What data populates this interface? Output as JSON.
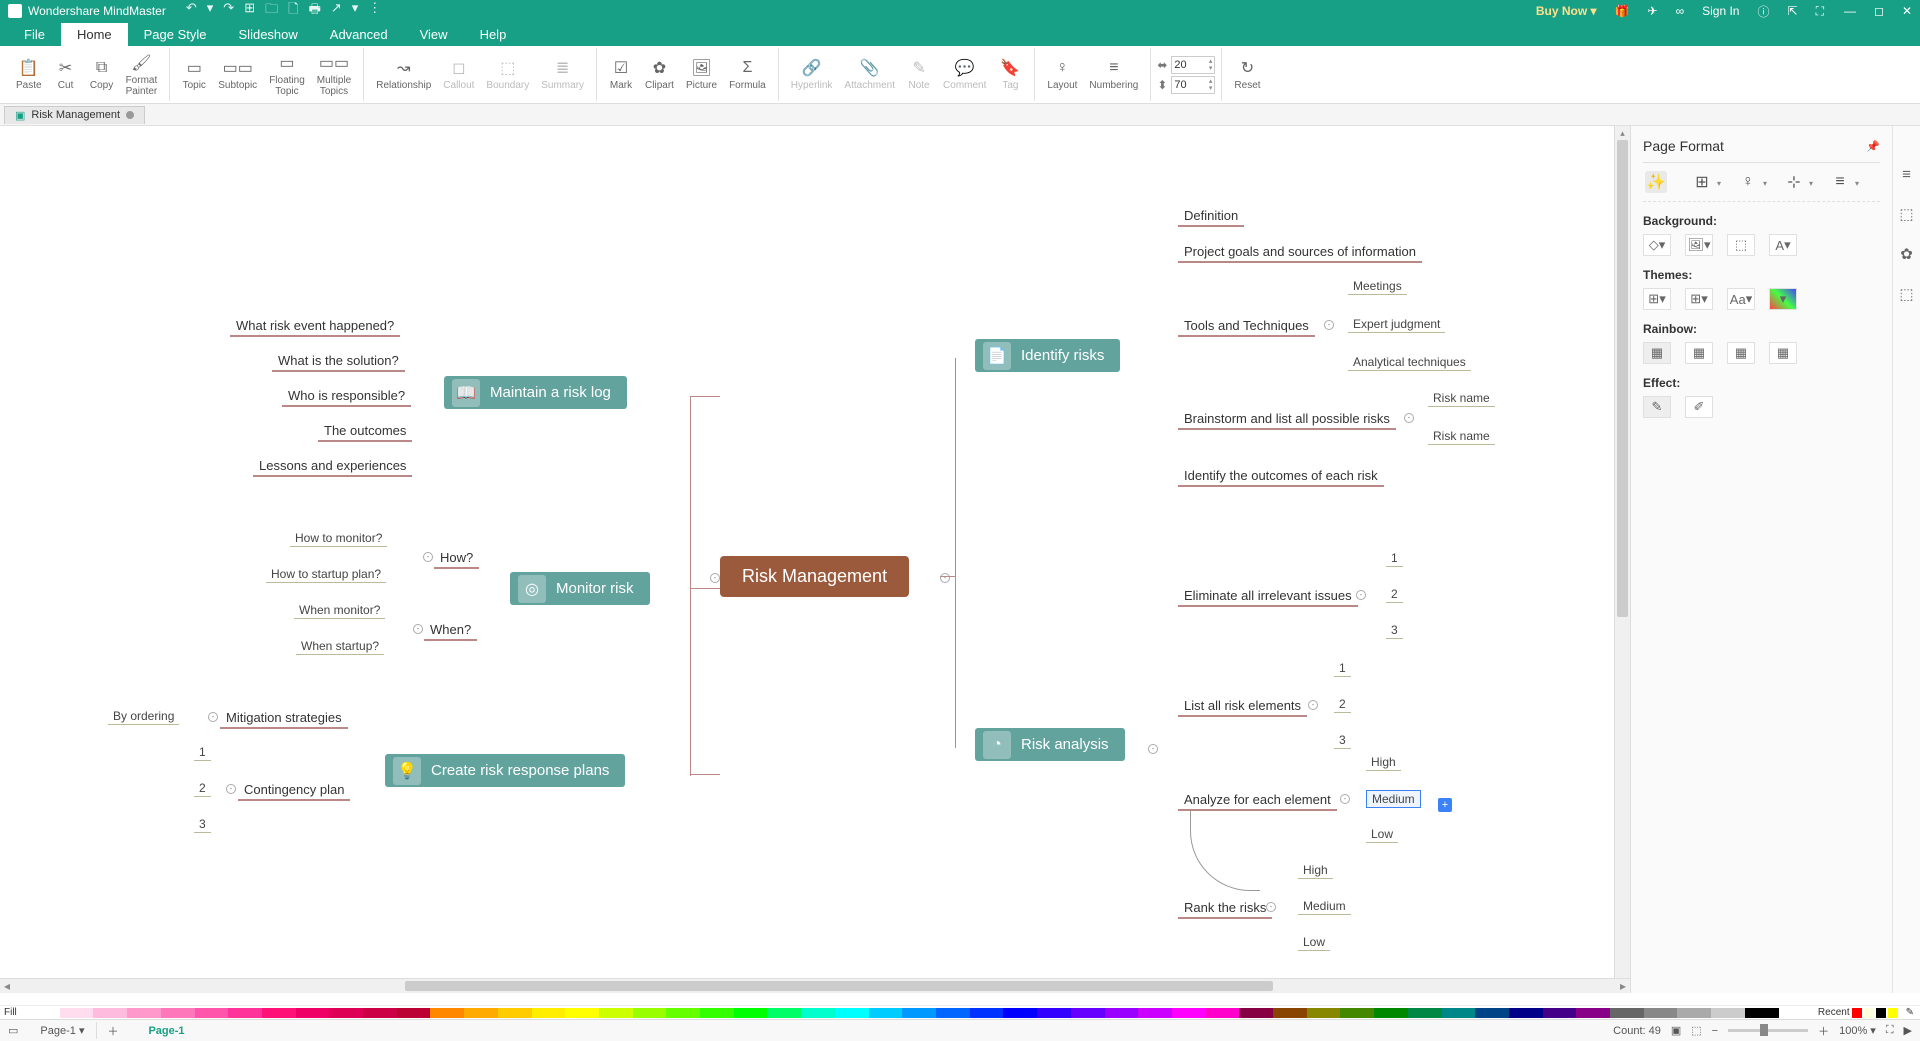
{
  "app": {
    "title": "Wondershare MindMaster"
  },
  "qat_icons": [
    "↶",
    "▾",
    "↷",
    "⊞",
    "🗀",
    "🗋",
    "🖶",
    "↗",
    "▾",
    "⋮"
  ],
  "titlebar_right": {
    "buy": "Buy Now ▾",
    "signin": "Sign In"
  },
  "menu_tabs": [
    "File",
    "Home",
    "Page Style",
    "Slideshow",
    "Advanced",
    "View",
    "Help"
  ],
  "menu_active": 1,
  "ribbon": {
    "groups": [
      {
        "items": [
          {
            "icon": "📋",
            "label": "Paste"
          },
          {
            "icon": "✂",
            "label": "Cut"
          },
          {
            "icon": "⧉",
            "label": "Copy"
          },
          {
            "icon": "🖌",
            "label": "Format\nPainter",
            "dd": true
          }
        ]
      },
      {
        "items": [
          {
            "icon": "▭",
            "label": "Topic"
          },
          {
            "icon": "▭▭",
            "label": "Subtopic"
          },
          {
            "icon": "▭",
            "label": "Floating\nTopic"
          },
          {
            "icon": "▭▭",
            "label": "Multiple\nTopics"
          }
        ]
      },
      {
        "items": [
          {
            "icon": "↝",
            "label": "Relationship"
          },
          {
            "icon": "◻",
            "label": "Callout",
            "dim": true
          },
          {
            "icon": "⬚",
            "label": "Boundary",
            "dim": true
          },
          {
            "icon": "≣",
            "label": "Summary",
            "dim": true
          }
        ]
      },
      {
        "items": [
          {
            "icon": "☑",
            "label": "Mark"
          },
          {
            "icon": "✿",
            "label": "Clipart"
          },
          {
            "icon": "🖼",
            "label": "Picture"
          },
          {
            "icon": "Σ",
            "label": "Formula"
          }
        ]
      },
      {
        "items": [
          {
            "icon": "🔗",
            "label": "Hyperlink",
            "dim": true
          },
          {
            "icon": "📎",
            "label": "Attachment",
            "dim": true
          },
          {
            "icon": "✎",
            "label": "Note",
            "dim": true
          },
          {
            "icon": "💬",
            "label": "Comment",
            "dim": true
          },
          {
            "icon": "🔖",
            "label": "Tag",
            "dim": true
          }
        ]
      },
      {
        "items": [
          {
            "icon": "♀",
            "label": "Layout",
            "dd": true
          },
          {
            "icon": "≡",
            "label": "Numbering",
            "dd": true
          }
        ]
      },
      {
        "spinners": [
          {
            "icon": "⬌",
            "value": "20"
          },
          {
            "icon": "⬍",
            "value": "70"
          }
        ],
        "reset": {
          "icon": "↻",
          "label": "Reset"
        }
      }
    ]
  },
  "doc_tab": "Risk Management",
  "mindmap": {
    "central": "Risk Management",
    "left": [
      {
        "title": "Maintain a risk log",
        "icon": "📖",
        "children": [
          "What risk event happened?",
          "What is the solution?",
          "Who is responsible?",
          "The outcomes",
          "Lessons and experiences"
        ]
      },
      {
        "title": "Monitor risk",
        "icon": "◎",
        "groups": [
          {
            "q": "How?",
            "items": [
              "How to monitor?",
              "How to startup plan?"
            ]
          },
          {
            "q": "When?",
            "items": [
              "When monitor?",
              "When startup?"
            ]
          }
        ]
      },
      {
        "title": "Create risk response plans",
        "icon": "💡",
        "pairs": [
          {
            "label": "Mitigation strategies",
            "left": "By ordering"
          },
          {
            "label": "Contingency plan",
            "nums": [
              "1",
              "2",
              "3"
            ]
          }
        ]
      }
    ],
    "right": [
      {
        "title": "Identify risks",
        "icon": "📄",
        "children": [
          {
            "t": "Definition"
          },
          {
            "t": "Project goals and sources of information"
          },
          {
            "t": "Tools and Techniques",
            "sub": [
              "Meetings",
              "Expert judgment",
              "Analytical techniques"
            ]
          },
          {
            "t": "Brainstorm and list all possible risks",
            "sub": [
              "Risk name",
              "Risk name"
            ]
          },
          {
            "t": "Identify the outcomes of each risk"
          }
        ]
      },
      {
        "title": "Risk analysis",
        "icon": "◔",
        "children": [
          {
            "t": "Eliminate all irrelevant issues",
            "sub": [
              "1",
              "2",
              "3"
            ]
          },
          {
            "t": "List all risk elements",
            "sub": [
              "1",
              "2",
              "3"
            ]
          },
          {
            "t": "Analyze for each element",
            "sub": [
              "High",
              "Medium",
              "Low"
            ],
            "sel": 1
          },
          {
            "t": "Rank the risks",
            "sub": [
              "High",
              "Medium",
              "Low"
            ]
          }
        ]
      }
    ]
  },
  "sidepanel": {
    "title": "Page Format",
    "toprow": [
      "✨",
      "⊞",
      "♀",
      "⊹",
      "≡"
    ],
    "background": "Background:",
    "bg_icons": [
      "◇",
      "🖼",
      "⬚",
      "A"
    ],
    "themes": "Themes:",
    "theme_icons": [
      "⊞",
      "⊞",
      "Aa",
      "▦"
    ],
    "rainbow": "Rainbow:",
    "effect": "Effect:",
    "vtabs": [
      "≡",
      "⬚",
      "✿",
      "⬚"
    ]
  },
  "colorbar": {
    "label": "Fill",
    "recent": "Recent",
    "colors": [
      "#ffffff",
      "#fde",
      "#fbd",
      "#f9c",
      "#f7b",
      "#f5a",
      "#f39",
      "#f17",
      "#e06",
      "#d05",
      "#c04",
      "#b03",
      "#f80",
      "#fa0",
      "#fc0",
      "#fe0",
      "#ff0",
      "#cf0",
      "#9f0",
      "#6f0",
      "#3f0",
      "#0f0",
      "#0f6",
      "#0fc",
      "#0ff",
      "#0cf",
      "#09f",
      "#06f",
      "#03f",
      "#00f",
      "#30f",
      "#60f",
      "#90f",
      "#c0f",
      "#f0f",
      "#f0c",
      "#804",
      "#840",
      "#880",
      "#480",
      "#080",
      "#084",
      "#088",
      "#048",
      "#008",
      "#408",
      "#808",
      "#666",
      "#888",
      "#aaa",
      "#ccc",
      "#000",
      "#fff"
    ],
    "recent_sw": [
      "#f00",
      "#ffd",
      "#000",
      "#ff0"
    ]
  },
  "status": {
    "page_tab": "Page-1",
    "page_active": "Page-1",
    "count": "Count: 49",
    "zoom": "100% ▾"
  }
}
